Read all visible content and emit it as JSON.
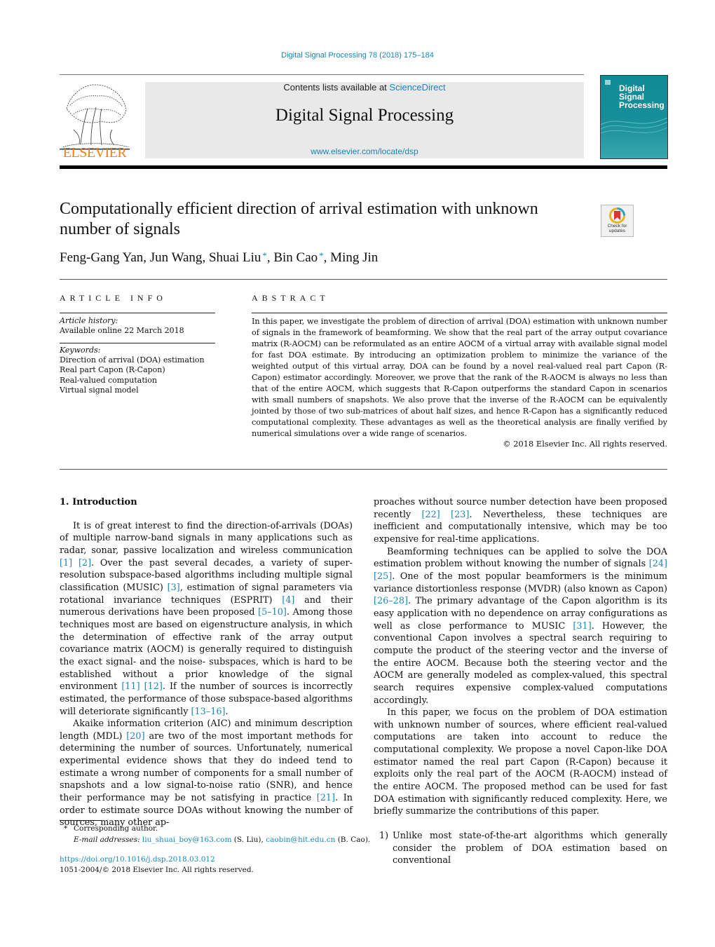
{
  "header": {
    "running_head": "Digital Signal Processing 78 (2018) 175–184",
    "contents_prefix": "Contents lists available at ",
    "contents_link": "ScienceDirect",
    "journal_name": "Digital Signal Processing",
    "journal_url": "www.elsevier.com/locate/dsp",
    "publisher_logo_text": "ELSEVIER",
    "cover_title_lines": [
      "Digital",
      "Signal",
      "Processing"
    ],
    "colors": {
      "link": "#1a86b8",
      "elsevier_orange": "#f07f1a",
      "cover_teal": "#178f9a"
    }
  },
  "article": {
    "title": "Computationally efficient direction of arrival estimation with unknown number of signals",
    "crossmark_label_lines": [
      "Check for",
      "updates"
    ],
    "authors": [
      {
        "name": "Feng-Gang Yan",
        "corresponding": false
      },
      {
        "name": "Jun Wang",
        "corresponding": false
      },
      {
        "name": "Shuai Liu",
        "corresponding": true
      },
      {
        "name": "Bin Cao",
        "corresponding": true
      },
      {
        "name": "Ming Jin",
        "corresponding": false
      }
    ],
    "corresponding_mark": "*"
  },
  "article_info": {
    "heading": "ARTICLE INFO",
    "history_label": "Article history:",
    "history_value": "Available online 22 March 2018",
    "keywords_label": "Keywords:",
    "keywords": [
      "Direction of arrival (DOA) estimation",
      "Real part Capon (R-Capon)",
      "Real-valued computation",
      "Virtual signal model"
    ]
  },
  "abstract": {
    "heading": "ABSTRACT",
    "text": "In this paper, we investigate the problem of direction of arrival (DOA) estimation with unknown number of signals in the framework of beamforming. We show that the real part of the array output covariance matrix (R-AOCM) can be reformulated as an entire AOCM of a virtual array with available signal model for fast DOA estimate. By introducing an optimization problem to minimize the variance of the weighted output of this virtual array, DOA can be found by a novel real-valued real part Capon (R-Capon) estimator accordingly. Moreover, we prove that the rank of the R-AOCM is always no less than that of the entire AOCM, which suggests that R-Capon outperforms the standard Capon in scenarios with small numbers of snapshots. We also prove that the inverse of the R-AOCM can be equivalently jointed by those of two sub-matrices of about half sizes, and hence R-Capon has a significantly reduced computational complexity. These advantages as well as the theoretical analysis are finally verified by numerical simulations over a wide range of scenarios.",
    "copyright": "© 2018 Elsevier Inc. All rights reserved."
  },
  "body": {
    "section_title": "1. Introduction",
    "left_paragraphs": [
      [
        {
          "t": "It is of great interest to find the direction-of-arrivals (DOAs) of multiple narrow-band signals in many applications such as radar, sonar, passive localization and wireless communication "
        },
        {
          "t": "[1]",
          "ref": true
        },
        {
          "t": " "
        },
        {
          "t": "[2]",
          "ref": true
        },
        {
          "t": ". Over the past several decades, a variety of super-resolution subspace-based algorithms including multiple signal classification (MUSIC) "
        },
        {
          "t": "[3]",
          "ref": true
        },
        {
          "t": ", estimation of signal parameters via rotational invariance techniques (ESPRIT) "
        },
        {
          "t": "[4]",
          "ref": true
        },
        {
          "t": " and their numerous derivations have been proposed "
        },
        {
          "t": "[5–10]",
          "ref": true
        },
        {
          "t": ". Among those techniques most are based on eigenstructure analysis, in which the determination of effective rank of the array output covariance matrix (AOCM) is generally required to distinguish the exact signal- and the noise- subspaces, which is hard to be established without a prior knowledge of the signal environment "
        },
        {
          "t": "[11]",
          "ref": true
        },
        {
          "t": " "
        },
        {
          "t": "[12]",
          "ref": true
        },
        {
          "t": ". If the number of sources is incorrectly estimated, the performance of those subspace-based algorithms will deteriorate significantly "
        },
        {
          "t": "[13–16]",
          "ref": true
        },
        {
          "t": "."
        }
      ],
      [
        {
          "t": "Akaike information criterion (AIC) and minimum description length (MDL) "
        },
        {
          "t": "[20]",
          "ref": true
        },
        {
          "t": " are two of the most important methods for determining the number of sources. Unfortunately, numerical experimental evidence shows that they do indeed tend to estimate a wrong number of components for a small number of snapshots and a low signal-to-noise ratio (SNR), and hence their performance may be not satisfying in practice "
        },
        {
          "t": "[21]",
          "ref": true
        },
        {
          "t": ". In order to estimate source DOAs without knowing the number of sources, many other ap-"
        }
      ]
    ],
    "right_continuation": [
      {
        "t": "proaches without source number detection have been proposed recently "
      },
      {
        "t": "[22]",
        "ref": true
      },
      {
        "t": " "
      },
      {
        "t": "[23]",
        "ref": true
      },
      {
        "t": ". Nevertheless, these techniques are inefficient and computationally intensive, which may be too expensive for real-time applications."
      }
    ],
    "right_paragraphs": [
      [
        {
          "t": "Beamforming techniques can be applied to solve the DOA estimation problem without knowing the number of signals "
        },
        {
          "t": "[24]",
          "ref": true
        },
        {
          "t": " "
        },
        {
          "t": "[25]",
          "ref": true
        },
        {
          "t": ". One of the most popular beamformers is the minimum variance distortionless response (MVDR) (also known as Capon) "
        },
        {
          "t": "[26–28]",
          "ref": true
        },
        {
          "t": ". The primary advantage of the Capon algorithm is its easy application with no dependence on array configurations as well as close performance to MUSIC "
        },
        {
          "t": "[31]",
          "ref": true
        },
        {
          "t": ". However, the conventional Capon involves a spectral search requiring to compute the product of the steering vector and the inverse of the entire AOCM. Because both the steering vector and the AOCM are generally modeled as complex-valued, this spectral search requires expensive complex-valued computations accordingly."
        }
      ],
      [
        {
          "t": "In this paper, we focus on the problem of DOA estimation with unknown number of sources, where efficient real-valued computations are taken into account to reduce the computational complexity. We propose a novel Capon-like DOA estimator named the real part Capon (R-Capon) because it exploits only the real part of the AOCM (R-AOCM) instead of the entire AOCM. The proposed method can be used for fast DOA estimation with significantly reduced complexity. Here, we briefly summarize the contributions of this paper."
        }
      ]
    ],
    "list_items": [
      {
        "num": "1)",
        "text": "Unlike most state-of-the-art algorithms which generally consider the problem of DOA estimation based on conventional"
      }
    ]
  },
  "footnotes": {
    "star": "*",
    "corresponding": "Corresponding author.",
    "email_label": "E-mail addresses: ",
    "emails": [
      {
        "address": "liu_shuai_boy@163.com",
        "who": " (S. Liu), "
      },
      {
        "address": "caobin@hit.edu.cn",
        "who": " (B. Cao)."
      }
    ],
    "doi": "https://doi.org/10.1016/j.dsp.2018.03.012",
    "issn_line": "1051-2004/© 2018 Elsevier Inc. All rights reserved."
  }
}
